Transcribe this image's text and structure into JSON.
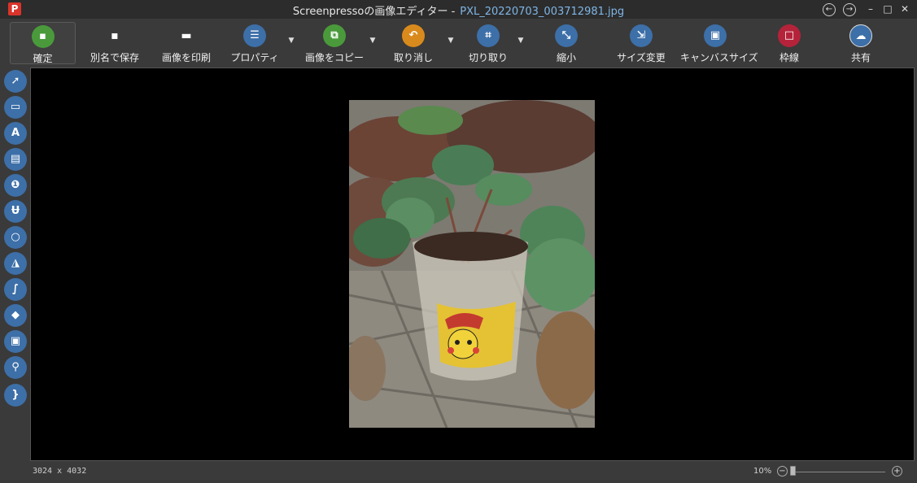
{
  "window": {
    "app_title": "Screenpressoの画像エディター -",
    "file_name": "PXL_20220703_003712981.jpg",
    "logo_text": "P"
  },
  "window_controls": {
    "back": "←",
    "forward": "→",
    "minimize": "–",
    "maximize": "□",
    "close": "✕"
  },
  "toolbar": {
    "items": [
      {
        "label": "確定",
        "icon": "save-icon",
        "glyph": "▪",
        "color": "#4a9a3c"
      },
      {
        "label": "別名で保存",
        "icon": "save-as-icon",
        "glyph": "▪",
        "color": ""
      },
      {
        "label": "画像を印刷",
        "icon": "print-icon",
        "glyph": "▬",
        "color": ""
      },
      {
        "label": "プロパティ",
        "icon": "list-icon",
        "glyph": "☰",
        "color": "#3d6fa8"
      },
      {
        "label": "画像をコピー",
        "icon": "copy-icon",
        "glyph": "⧉",
        "color": "#4a9a3c"
      },
      {
        "label": "取り消し",
        "icon": "undo-icon",
        "glyph": "↶",
        "color": "#d98a1c"
      },
      {
        "label": "切り取り",
        "icon": "crop-icon",
        "glyph": "⌗",
        "color": "#3d6fa8"
      },
      {
        "label": "縮小",
        "icon": "shrink-icon",
        "glyph": "⤡",
        "color": "#3d6fa8"
      },
      {
        "label": "サイズ変更",
        "icon": "resize-icon",
        "glyph": "⇲",
        "color": "#3d6fa8"
      },
      {
        "label": "キャンバスサイズ",
        "icon": "canvas-size-icon",
        "glyph": "▣",
        "color": "#3d6fa8"
      },
      {
        "label": "枠線",
        "icon": "border-icon",
        "glyph": "□",
        "color": "#b4233a"
      },
      {
        "label": "共有",
        "icon": "cloud-upload-icon",
        "glyph": "☁",
        "color": "#3d6fa8"
      }
    ],
    "caret": "▼"
  },
  "toolbox": [
    {
      "icon": "arrow-tool-icon",
      "glyph": "➚"
    },
    {
      "icon": "rectangle-tool-icon",
      "glyph": "▭"
    },
    {
      "icon": "text-tool-icon",
      "glyph": "A"
    },
    {
      "icon": "callout-tool-icon",
      "glyph": "▤"
    },
    {
      "icon": "numbering-tool-icon",
      "glyph": "❶"
    },
    {
      "icon": "magnet-tool-icon",
      "glyph": "Ʉ"
    },
    {
      "icon": "ellipse-tool-icon",
      "glyph": "○"
    },
    {
      "icon": "highlighter-tool-icon",
      "glyph": "◮"
    },
    {
      "icon": "freehand-tool-icon",
      "glyph": "∫"
    },
    {
      "icon": "blur-tool-icon",
      "glyph": "◆"
    },
    {
      "icon": "image-tool-icon",
      "glyph": "▣"
    },
    {
      "icon": "magnifier-tool-icon",
      "glyph": "⚲"
    },
    {
      "icon": "brace-tool-icon",
      "glyph": "}"
    }
  ],
  "status": {
    "dimensions": "3024 x 4032",
    "zoom": "10%",
    "zoom_fraction": 0.02,
    "zoom_minus": "−",
    "zoom_plus": "+"
  }
}
